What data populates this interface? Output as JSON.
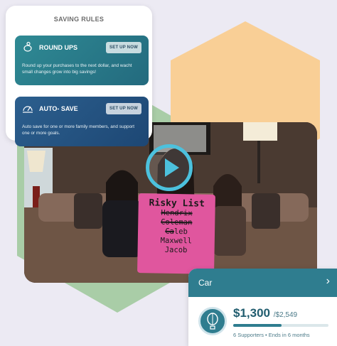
{
  "saving_rules": {
    "title": "SAVING RULES",
    "rules": [
      {
        "name": "ROUND UPS",
        "button": "SET UP NOW",
        "description": "Round up your purchases to the next dollar, and wacht small changes grow into big savings!",
        "icon": "piggy-bank-icon"
      },
      {
        "name": "AUTO- SAVE",
        "button": "SET UP NOW",
        "description": "Auto save for one or more family members, and support one or more goals.",
        "icon": "auto-save-gauge-icon"
      }
    ]
  },
  "video": {
    "sign": {
      "title": "Risky List",
      "lines": [
        "Hendrix",
        "Coleman",
        "Caleb",
        "Maxwell",
        "Jacob"
      ]
    },
    "play_icon": "play-icon"
  },
  "goal": {
    "name": "Car",
    "amount": "$1,300",
    "target": "/$2,549",
    "progress": 0.51,
    "meta": "6 Supporters • Ends in 6 months",
    "icon": "hot-air-balloon-icon"
  },
  "colors": {
    "hex_green": "#a9cda7",
    "hex_orange": "#f9cf96",
    "teal": "#2f7d8f",
    "play_blue": "#4cc1dd",
    "sign_pink": "#e0569e"
  }
}
